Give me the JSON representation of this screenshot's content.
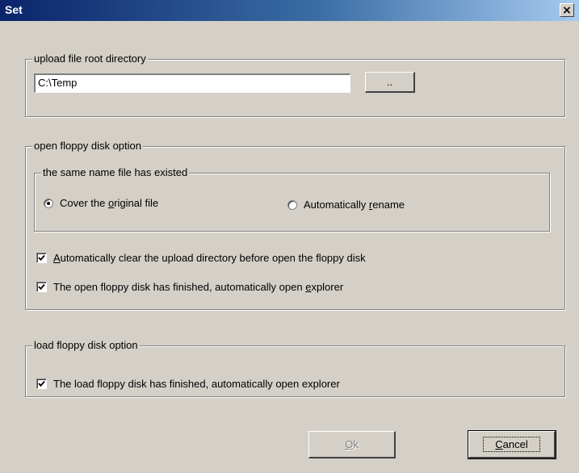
{
  "window": {
    "title": "Set",
    "close_glyph": "×",
    "close_icon": "close-icon"
  },
  "upload_group": {
    "label": "upload file root directory",
    "path_value": "C:\\Temp",
    "browse_label": ".."
  },
  "open_group": {
    "label": "open floppy disk option",
    "same_name_group": {
      "label": "the same name file has existed",
      "options": [
        {
          "pre": "Cover the ",
          "accel": "o",
          "post": "riginal file",
          "checked": true
        },
        {
          "pre": "Automatically ",
          "accel": "r",
          "post": "ename",
          "checked": false
        }
      ]
    },
    "checks": [
      {
        "pre": "",
        "accel": "A",
        "post": "utomatically clear the upload directory before open the floppy disk",
        "checked": true
      },
      {
        "pre": "The open floppy disk has finished, automatically open ",
        "accel": "e",
        "post": "xplorer",
        "checked": true
      }
    ]
  },
  "load_group": {
    "label": "load floppy disk option",
    "checks": [
      {
        "pre": "The load floppy disk has finished, automatically open explorer",
        "accel": "",
        "post": "",
        "checked": true
      }
    ]
  },
  "buttons": {
    "ok": {
      "accel": "O",
      "post": "k",
      "enabled": false
    },
    "cancel": {
      "accel": "C",
      "post": "ancel",
      "enabled": true
    }
  }
}
